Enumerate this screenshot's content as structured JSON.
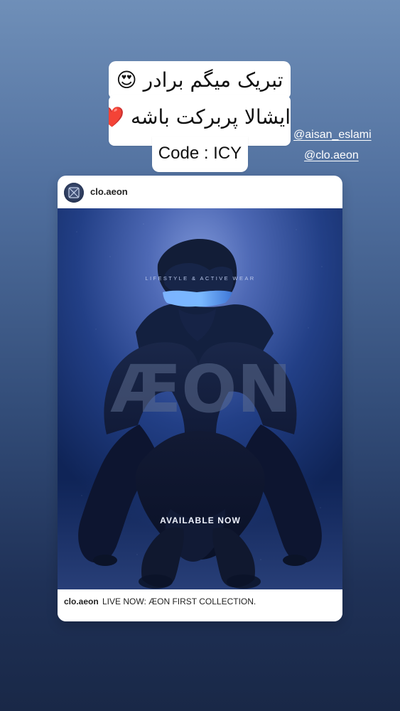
{
  "caption": {
    "line1": "تبریک میگم برادر 😍",
    "line2": "ایشالا پربرکت باشه ❤️",
    "line3": "Code : ICY"
  },
  "mentions": [
    "@aisan_eslami",
    "@clo.aeon"
  ],
  "post": {
    "username": "clo.aeon",
    "media": {
      "tagline": "LIFESTYLE & ACTIVE WEAR",
      "logo": "ÆON",
      "cta": "AVAILABLE NOW"
    },
    "caption_username": "clo.aeon",
    "caption_text": "LIVE NOW: ÆON FIRST COLLECTION."
  }
}
